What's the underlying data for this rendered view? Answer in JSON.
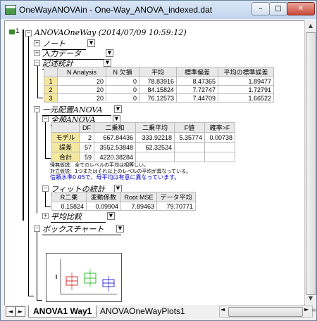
{
  "window": {
    "title": "OneWayANOVAin - One-Way_ANOVA_indexed.dat",
    "buttons": {
      "minimize": "–",
      "maximize": "□",
      "close": "✕"
    }
  },
  "report": {
    "row_number": "1",
    "root": "ANOVAOneWay (2014/07/09 10:59:12)",
    "notes": "ノート",
    "input_data": "入力データ",
    "desc_stats": {
      "title": "記述統計",
      "columns": [
        "",
        "N Analysis",
        "N 欠損",
        "平均",
        "標準偏差",
        "平均の標準誤差"
      ],
      "rows": [
        [
          "1",
          "20",
          "0",
          "78.83916",
          "8.47365",
          "1.89477"
        ],
        [
          "2",
          "20",
          "0",
          "84.15824",
          "7.72747",
          "1.72791"
        ],
        [
          "3",
          "20",
          "0",
          "76.12573",
          "7.44709",
          "1.66522"
        ]
      ]
    },
    "oneway": {
      "title": "一元配置ANOVA",
      "overall": {
        "title": "全般ANOVA",
        "columns": [
          "",
          "DF",
          "二乗和",
          "二乗平均",
          "F値",
          "確率>F"
        ],
        "rows": [
          [
            "モデル",
            "2",
            "667.84436",
            "333.92218",
            "5.35774",
            "0.00738"
          ],
          [
            "誤差",
            "57",
            "3552.53848",
            "62.32524",
            "",
            ""
          ],
          [
            "合計",
            "59",
            "4220.38284",
            "",
            "",
            ""
          ]
        ]
      },
      "null_hyp": "帰無仮説：全てのレベルの平均は相等しい。",
      "alt_hyp": "対立仮説：1つまたはそれ以上のレベルの平均が異なっている。",
      "conclusion": "信頼水準0.05で、母平均は有意に異なっています。",
      "fit": {
        "title": "フィットの統計",
        "columns": [
          "R二乗",
          "変動係数",
          "Root MSE",
          "データ平均"
        ],
        "row": [
          "0.15824",
          "0.09904",
          "7.89463",
          "79.70771"
        ]
      },
      "means_comparison": "平均比較"
    },
    "boxchart": {
      "title": "ボックスチャート"
    }
  },
  "tabs": {
    "active": "ANOVA1 Way1",
    "other": "ANOVAOneWayPlots1"
  },
  "scroll": {
    "up": "▲",
    "down": "▼",
    "left": "◄",
    "right": "►",
    "grip": "≡"
  },
  "colors": {
    "accent_blue": "#0000cc",
    "row_header": "#f4e7a0",
    "box1": "#cc0000",
    "box2": "#00aa00",
    "box3": "#0000cc"
  }
}
